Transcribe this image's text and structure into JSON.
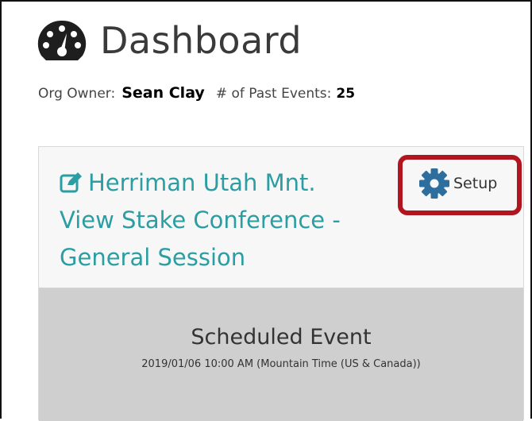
{
  "page": {
    "title": "Dashboard",
    "title_icon": "dashboard-gauge-icon"
  },
  "meta": {
    "owner_label": "Org Owner:",
    "owner_name": "Sean Clay",
    "events_label": "# of Past Events:",
    "events_count": "25"
  },
  "event_card": {
    "edit_icon": "edit-icon",
    "title": "Herriman Utah Mnt. View Stake Conference - General Session",
    "setup_label": "Setup",
    "setup_icon": "gear-icon",
    "status": "Scheduled Event",
    "datetime": "2019/01/06 10:00 AM (Mountain Time (US & Canada))"
  },
  "colors": {
    "accent_teal": "#2a9ea3",
    "highlight_red": "#b11520",
    "gear_blue": "#2e6e9e"
  }
}
